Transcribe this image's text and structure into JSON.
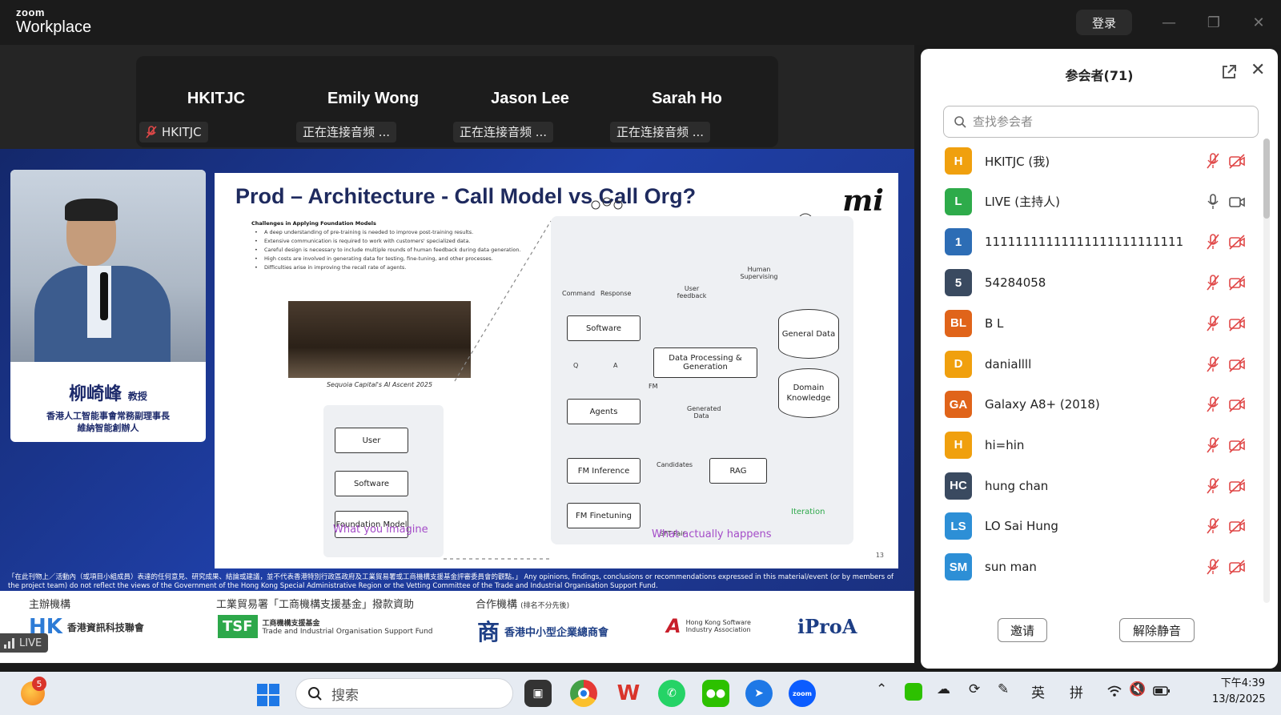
{
  "app": {
    "brand_small": "zoom",
    "brand_big": "Workplace",
    "login_label": "登录"
  },
  "tiles": [
    {
      "name": "HKITJC",
      "status": "HKITJC"
    },
    {
      "name": "Emily Wong",
      "status": "正在连接音频 ..."
    },
    {
      "name": "Jason Lee",
      "status": "正在连接音频 ..."
    },
    {
      "name": "Sarah Ho",
      "status": "正在连接音频 ..."
    }
  ],
  "speaker": {
    "name": "柳崎峰",
    "honorific": "教授",
    "title_line1": "香港人工智能事會常務副理事長",
    "title_line2": "維納智能創辦人"
  },
  "slide": {
    "title": "Prod – Architecture - Call Model vs Call Org?",
    "logo": "mi",
    "challenges_title": "Challenges in Applying Foundation Models",
    "challenges": [
      "A deep understanding of pre-training is needed to improve post-training results.",
      "Extensive communication is required to work with customers' specialized data.",
      "Careful design is necessary to include multiple rounds of human feedback during data generation.",
      "High costs are involved in generating data for testing, fine-tuning, and other processes.",
      "Difficulties arise in improving the recall rate of agents."
    ],
    "photo_caption": "Sequoia Capital's AI Ascent 2025",
    "imagine": {
      "user": "User",
      "software": "Software",
      "foundation": "Foundation Model",
      "label": "What you imagine"
    },
    "actual": {
      "software": "Software",
      "agents": "Agents",
      "fm_inference": "FM Inference",
      "fm_finetuning": "FM Finetuning",
      "data_proc": "Data Processing & Generation",
      "rag": "RAG",
      "general_data": "General Data",
      "domain_knowledge": "Domain Knowledge",
      "command": "Command",
      "response": "Response",
      "user_feedback": "User feedback",
      "human_supervising": "Human Supervising",
      "q": "Q",
      "a": "A",
      "fm": "FM",
      "generated_data": "Generated Data",
      "candidates": "Candidates",
      "sft_pair": "SFT Pair",
      "iteration": "Iteration",
      "label": "What actually happens"
    },
    "page": "13"
  },
  "disclaimer": "「在此刊物上／活動內（或項目小組成員）表達的任何意見、研究成果、結論或建議，並不代表香港特別行政區政府及工業貿易署或工商機構支援基金評審委員會的觀點。」 Any opinions, findings, conclusions or recommendations expressed in this material/event (or by members of the project team) do not reflect the views of the Government of the Hong Kong Special Administrative Region or the Vetting Committee of the Trade and Industrial Organisation Support Fund.",
  "sponsors": {
    "organizer_hdr": "主辦機構",
    "funding_hdr": "工業貿易署「工商機構支援基金」撥款資助",
    "partner_hdr": "合作機構",
    "partner_note": "(排名不分先後)",
    "organizer_name": "香港資訊科技聯會",
    "tsf_name": "工商機構支援基金",
    "tsf_en": "Trade and Industrial Organisation Support Fund",
    "gccsme": "香港中小型企業總商會",
    "hkisa": "Hong Kong Software Industry Association",
    "ipro": "iProA"
  },
  "live_badge": "LIVE",
  "panel": {
    "title": "参会者(71)",
    "search_placeholder": "查找参会者",
    "invite_label": "邀请",
    "unmute_label": "解除静音",
    "participants": [
      {
        "initials": "H",
        "name": "HKITJC (我)",
        "color": "#f0a00e",
        "muted": true
      },
      {
        "initials": "L",
        "name": "LIVE (主持人)",
        "color": "#2eab4a",
        "muted": false
      },
      {
        "initials": "1",
        "name": "11111111111111111111111111",
        "color": "#2d6db5",
        "muted": true
      },
      {
        "initials": "5",
        "name": "54284058",
        "color": "#3a4a60",
        "muted": true
      },
      {
        "initials": "BL",
        "name": "B L",
        "color": "#e0641a",
        "muted": true
      },
      {
        "initials": "D",
        "name": "daniallll",
        "color": "#f0a00e",
        "muted": true
      },
      {
        "initials": "GA",
        "name": "Galaxy A8+ (2018)",
        "color": "#e0641a",
        "muted": true
      },
      {
        "initials": "H",
        "name": "hi=hin",
        "color": "#f0a00e",
        "muted": true
      },
      {
        "initials": "HC",
        "name": "hung chan",
        "color": "#3a4a60",
        "muted": true
      },
      {
        "initials": "LS",
        "name": "LO Sai Hung",
        "color": "#2d8fd6",
        "muted": true
      },
      {
        "initials": "SM",
        "name": "sun man",
        "color": "#2d8fd6",
        "muted": true
      }
    ]
  },
  "taskbar": {
    "search_label": "搜索",
    "badge": "5",
    "ime_en": "英",
    "ime_pin": "拼",
    "time": "下午4:39",
    "date": "13/8/2025"
  }
}
